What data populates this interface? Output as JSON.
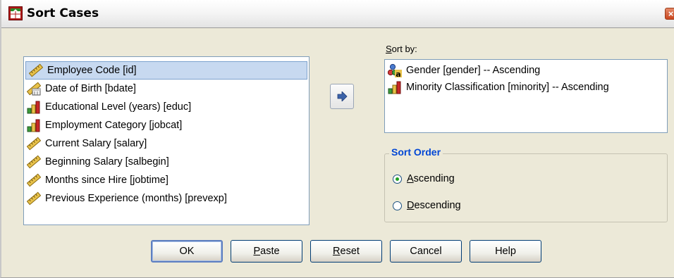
{
  "window": {
    "title": "Sort Cases",
    "close_glyph": "×"
  },
  "variables": {
    "items": [
      {
        "label": "Employee Code [id]",
        "icon": "scale-ruler-icon",
        "selected": true
      },
      {
        "label": "Date of Birth [bdate]",
        "icon": "date-scale-icon",
        "selected": false
      },
      {
        "label": "Educational Level (years) [educ]",
        "icon": "ordinal-bars-icon",
        "selected": false
      },
      {
        "label": "Employment Category [jobcat]",
        "icon": "ordinal-bars-icon",
        "selected": false
      },
      {
        "label": "Current Salary [salary]",
        "icon": "scale-ruler-icon",
        "selected": false
      },
      {
        "label": "Beginning Salary [salbegin]",
        "icon": "scale-ruler-icon",
        "selected": false
      },
      {
        "label": "Months since Hire [jobtime]",
        "icon": "scale-ruler-icon",
        "selected": false
      },
      {
        "label": "Previous Experience (months) [prevexp]",
        "icon": "scale-ruler-icon",
        "selected": false
      }
    ]
  },
  "sort_by": {
    "label_mnemonic": "S",
    "label_rest": "ort by:",
    "items": [
      {
        "label": "Gender [gender] -- Ascending",
        "icon": "nominal-string-icon"
      },
      {
        "label": "Minority Classification [minority] -- Ascending",
        "icon": "ordinal-bars-icon"
      }
    ]
  },
  "move_button": {
    "icon": "right-arrow-icon"
  },
  "sort_order": {
    "title": "Sort Order",
    "options": [
      {
        "mnemonic": "A",
        "rest": "scending",
        "checked": true
      },
      {
        "mnemonic": "D",
        "rest": "escending",
        "checked": false
      }
    ]
  },
  "buttons": {
    "ok": "OK",
    "paste_mnemonic": "P",
    "paste_rest": "aste",
    "reset_mnemonic": "R",
    "reset_rest": "eset",
    "cancel": "Cancel",
    "help": "Help"
  },
  "colors": {
    "accent": "#0046d5",
    "selection": "#c7d9f0",
    "window_bg": "#ece9d8"
  }
}
